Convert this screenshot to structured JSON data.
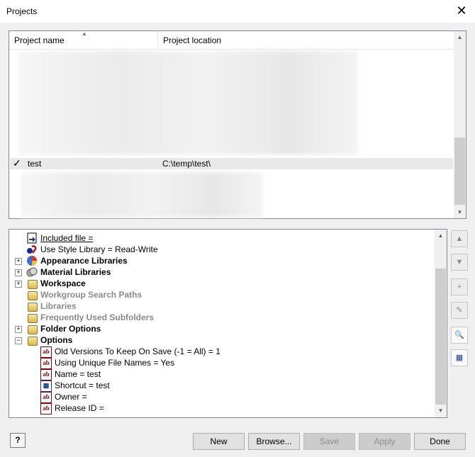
{
  "window": {
    "title": "Projects",
    "close_glyph": "✕"
  },
  "project_list": {
    "columns": [
      "Project name",
      "Project location"
    ],
    "rows": [
      {
        "name": "test",
        "location": "C:\\temp\\test\\",
        "active": true,
        "check": "✓"
      }
    ]
  },
  "tree": {
    "items": [
      {
        "label": "Included file =",
        "style": "ul",
        "icon": "included-file-icon",
        "indent": 0,
        "expander": null
      },
      {
        "label": "Use Style Library = Read-Write",
        "style": "normal",
        "icon": "style-library-icon",
        "indent": 0,
        "expander": null
      },
      {
        "label": "Appearance Libraries",
        "style": "bold",
        "icon": "appearance-icon",
        "indent": 0,
        "expander": "+"
      },
      {
        "label": "Material Libraries",
        "style": "bold",
        "icon": "material-icon",
        "indent": 0,
        "expander": "+"
      },
      {
        "label": "Workspace",
        "style": "bold",
        "icon": "folder-icon",
        "indent": 0,
        "expander": "+"
      },
      {
        "label": "Workgroup Search Paths",
        "style": "gray",
        "icon": "folder-icon",
        "indent": 0,
        "expander": null
      },
      {
        "label": "Libraries",
        "style": "gray",
        "icon": "folder-icon",
        "indent": 0,
        "expander": null
      },
      {
        "label": "Frequently Used Subfolders",
        "style": "gray",
        "icon": "folder-icon",
        "indent": 0,
        "expander": null
      },
      {
        "label": "Folder Options",
        "style": "bold",
        "icon": "folder-icon",
        "indent": 0,
        "expander": "+"
      },
      {
        "label": "Options",
        "style": "bold",
        "icon": "folder-icon",
        "indent": 0,
        "expander": "−"
      },
      {
        "label": "Old Versions To Keep On Save (-1 = All) = 1",
        "style": "normal",
        "icon": "text-value-icon",
        "indent": 1,
        "expander": null
      },
      {
        "label": "Using Unique File Names = Yes",
        "style": "normal",
        "icon": "text-value-icon",
        "indent": 1,
        "expander": null
      },
      {
        "label": "Name = test",
        "style": "normal",
        "icon": "text-value-icon",
        "indent": 1,
        "expander": null
      },
      {
        "label": "Shortcut = test",
        "style": "normal",
        "icon": "shortcut-icon",
        "indent": 1,
        "expander": null
      },
      {
        "label": "Owner =",
        "style": "normal",
        "icon": "text-value-icon",
        "indent": 1,
        "expander": null
      },
      {
        "label": "Release ID =",
        "style": "normal",
        "icon": "text-value-icon",
        "indent": 1,
        "expander": null
      }
    ],
    "ab_glyph": "ab"
  },
  "side_buttons": [
    {
      "name": "move-up-button",
      "glyph": "▲"
    },
    {
      "name": "move-down-button",
      "glyph": "▼"
    },
    {
      "name": "add-path-button",
      "glyph": "+"
    },
    {
      "name": "edit-path-button",
      "glyph": "✎"
    },
    {
      "name": "find-path-button",
      "glyph": "🔍"
    },
    {
      "name": "edit-options-button",
      "glyph": "▦"
    }
  ],
  "footer": {
    "help": "?",
    "buttons": [
      {
        "name": "new-button",
        "label": "New",
        "enabled": true
      },
      {
        "name": "browse-button",
        "label": "Browse...",
        "enabled": true
      },
      {
        "name": "save-button",
        "label": "Save",
        "enabled": false
      },
      {
        "name": "apply-button",
        "label": "Apply",
        "enabled": false
      },
      {
        "name": "done-button",
        "label": "Done",
        "enabled": true
      }
    ]
  }
}
